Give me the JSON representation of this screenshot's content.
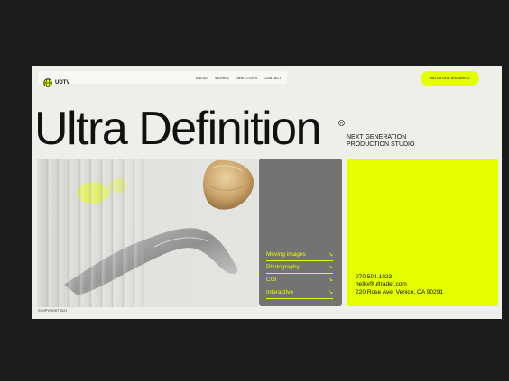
{
  "header": {
    "brand": "UDTV",
    "nav": [
      "ABOUT",
      "WORKS",
      "DIRECTORS",
      "CONTACT"
    ],
    "cta": "WATCH OUR SHOWREEL"
  },
  "hero": {
    "title": "Ultra Definition",
    "tagline_line1": "NEXT GENERATION",
    "tagline_line2": "PRODUCTION STUDIO"
  },
  "menu": [
    {
      "label": "Moving images",
      "icon": "arrow-down-right-icon"
    },
    {
      "label": "Photography",
      "icon": "arrow-down-right-icon"
    },
    {
      "label": "CGI",
      "icon": "arrow-down-right-icon"
    },
    {
      "label": "Interactive",
      "icon": "arrow-down-right-icon"
    }
  ],
  "contact": {
    "phone": "070.504.1023",
    "email": "hello@ultradef.com",
    "address": "220 Rose Ave, Venice, CA 90291"
  },
  "footer": {
    "copyright": "©COPYRIGHT 2021"
  },
  "colors": {
    "accent": "#e5ff00",
    "background": "#1c1c1c",
    "page": "#efefe9",
    "card": "#737373",
    "text": "#111111"
  }
}
